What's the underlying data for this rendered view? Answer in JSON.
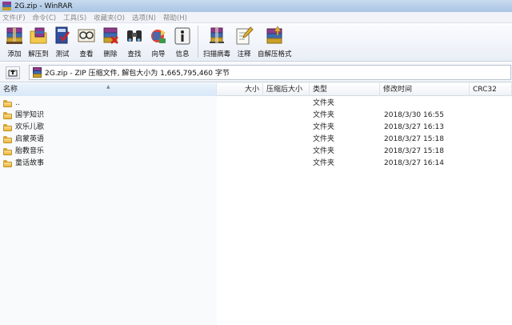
{
  "window": {
    "title": "2G.zip - WinRAR"
  },
  "menu": [
    "文件(F)",
    "命令(C)",
    "工具(S)",
    "收藏夹(O)",
    "选项(N)",
    "帮助(H)"
  ],
  "toolbar": {
    "buttons": [
      {
        "label": "添加",
        "icon": "add-archive-icon"
      },
      {
        "label": "解压到",
        "icon": "extract-to-icon"
      },
      {
        "label": "测试",
        "icon": "test-archive-icon"
      },
      {
        "label": "查看",
        "icon": "view-icon"
      },
      {
        "label": "删除",
        "icon": "delete-icon"
      },
      {
        "label": "查找",
        "icon": "find-binoculars-icon"
      },
      {
        "label": "向导",
        "icon": "wizard-icon"
      },
      {
        "label": "信息",
        "icon": "info-icon"
      },
      {
        "label": "扫描病毒",
        "icon": "virus-scan-icon"
      },
      {
        "label": "注释",
        "icon": "comment-icon"
      },
      {
        "label": "自解压格式",
        "icon": "sfx-icon"
      }
    ]
  },
  "address": {
    "path": "2G.zip - ZIP 压缩文件, 解包大小为 1,665,795,460 字节"
  },
  "columns": {
    "name": "名称",
    "size": "大小",
    "packed": "压缩后大小",
    "type": "类型",
    "modified": "修改时间",
    "crc": "CRC32"
  },
  "rows": [
    {
      "name": "..",
      "type": "文件夹",
      "modified": ""
    },
    {
      "name": "国学知识",
      "type": "文件夹",
      "modified": "2018/3/30 16:55"
    },
    {
      "name": "欢乐儿歌",
      "type": "文件夹",
      "modified": "2018/3/27 16:13"
    },
    {
      "name": "启蒙英语",
      "type": "文件夹",
      "modified": "2018/3/27 15:18"
    },
    {
      "name": "胎教音乐",
      "type": "文件夹",
      "modified": "2018/3/27 15:18"
    },
    {
      "name": "童话故事",
      "type": "文件夹",
      "modified": "2018/3/27 16:14"
    }
  ]
}
